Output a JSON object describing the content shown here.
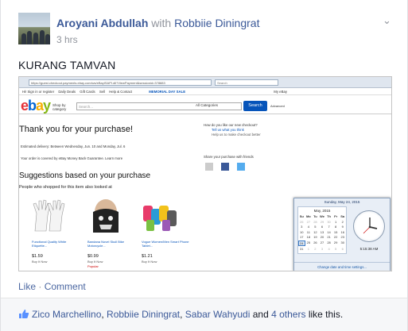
{
  "post": {
    "author": "Aroyani Abdullah",
    "with_text": "with",
    "tagged": "Robbiie Diningrat",
    "time": "3 hrs",
    "status": "KURANG TAMVAN"
  },
  "screenshot": {
    "url": "https://guest.checkout.payments.ebay.com/ws/eBayISAPI.dll?ViewPayment&sessionid=378883",
    "search_placeholder": "Search",
    "nav_items": [
      "Hi! Sign in or register",
      "Daily Deals",
      "Gift Cards",
      "Sell",
      "Help & Contact",
      "MEMORIAL DAY SALE",
      "My eBay"
    ],
    "shop_by": "Shop by category",
    "search_hint": "Search...",
    "category": "All Categories",
    "search_button": "Search",
    "advanced": "Advanced",
    "thank_you": "Thank you for your purchase!",
    "delivery": "Estimated delivery: Between Wednesday, Jun. 10 and Monday, Jul. 6",
    "covered": "Your order is covered by eBay Money Back Guarantee. Learn more",
    "suggestions": "Suggestions based on your purchase",
    "people_also": "People who shopped for this item also looked at",
    "products": [
      {
        "label": "Functional Quality White Etiquette...",
        "price": "$1.59",
        "sub": "Buy It Now",
        "popular": ""
      },
      {
        "label": "Bandana Novel Skull Bike Motorcycle...",
        "price": "$0.99",
        "sub": "Buy It Now",
        "popular": "Popular"
      },
      {
        "label": "Vogue Women/Men Smart Phone Tablet...",
        "price": "$1.21",
        "sub": "Buy It Now",
        "popular": ""
      }
    ],
    "checkout_q": "How do you like our new checkout?",
    "tell_us": "Tell us what you think",
    "help_us": "Help us to make checkout better",
    "share": "Share your purchase with friends",
    "clock": {
      "date": "Sunday, May 24, 2015",
      "month": "May, 2015",
      "days": [
        "Su",
        "Mo",
        "Tu",
        "We",
        "Th",
        "Fr",
        "Sa"
      ],
      "cells": [
        "26",
        "27",
        "28",
        "29",
        "30",
        "1",
        "2",
        "3",
        "4",
        "5",
        "6",
        "7",
        "8",
        "9",
        "10",
        "11",
        "12",
        "13",
        "14",
        "15",
        "16",
        "17",
        "18",
        "19",
        "20",
        "21",
        "22",
        "23",
        "24",
        "25",
        "26",
        "27",
        "28",
        "29",
        "30",
        "31",
        "1",
        "2",
        "3",
        "4",
        "5",
        "6"
      ],
      "time": "5:15:38 AM",
      "change": "Change date and time settings..."
    }
  },
  "actions": {
    "like": "Like",
    "dot": "·",
    "comment": "Comment"
  },
  "likers": {
    "n1": "Zico Marchellino",
    "n2": "Robbiie Diningrat",
    "n3": "Sabar Wahyudi",
    "and": "and",
    "others": "4 others",
    "suffix": "like this."
  }
}
